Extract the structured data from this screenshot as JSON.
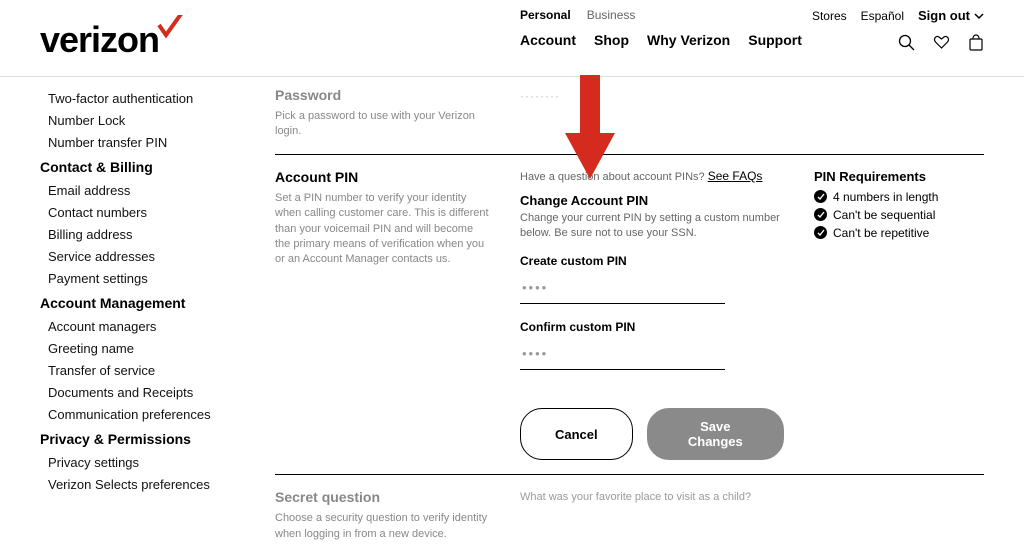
{
  "header": {
    "brand": "verizon",
    "top_tabs": {
      "personal": "Personal",
      "business": "Business"
    },
    "main_nav": [
      "Account",
      "Shop",
      "Why Verizon",
      "Support"
    ],
    "util": {
      "stores": "Stores",
      "espanol": "Español",
      "signout": "Sign out"
    }
  },
  "sidebar": {
    "items_top": [
      "Two-factor authentication",
      "Number Lock",
      "Number transfer PIN"
    ],
    "h_contact": "Contact & Billing",
    "items_contact": [
      "Email address",
      "Contact numbers",
      "Billing address",
      "Service addresses",
      "Payment settings"
    ],
    "h_acct": "Account Management",
    "items_acct": [
      "Account managers",
      "Greeting name",
      "Transfer of service",
      "Documents and Receipts",
      "Communication preferences"
    ],
    "h_priv": "Privacy & Permissions",
    "items_priv": [
      "Privacy settings",
      "Verizon Selects preferences"
    ]
  },
  "password_section": {
    "title": "Password",
    "desc": "Pick a password to use with your Verizon login.",
    "masked": "········"
  },
  "pin_section": {
    "title": "Account PIN",
    "desc": "Set a PIN number to verify your identity when calling customer care. This is different than your voicemail PIN and will become the primary means of verification when you or an Account Manager contacts us.",
    "faq_text_pre": "Have a question about account PINs? ",
    "faq_link": "See FAQs",
    "change_h": "Change Account PIN",
    "change_p": "Change your current PIN by setting a custom number below. Be sure not to use your SSN.",
    "create_label": "Create custom PIN",
    "confirm_label": "Confirm custom PIN",
    "pin_mask": "····",
    "cancel": "Cancel",
    "save": "Save Changes",
    "req_h": "PIN Requirements",
    "reqs": [
      "4 numbers in length",
      "Can't be sequential",
      "Can't be repetitive"
    ]
  },
  "secret_section": {
    "title": "Secret question",
    "desc": "Choose a security question to verify identity when logging in from a new device.",
    "question": "What was your favorite place to visit as a child?"
  }
}
